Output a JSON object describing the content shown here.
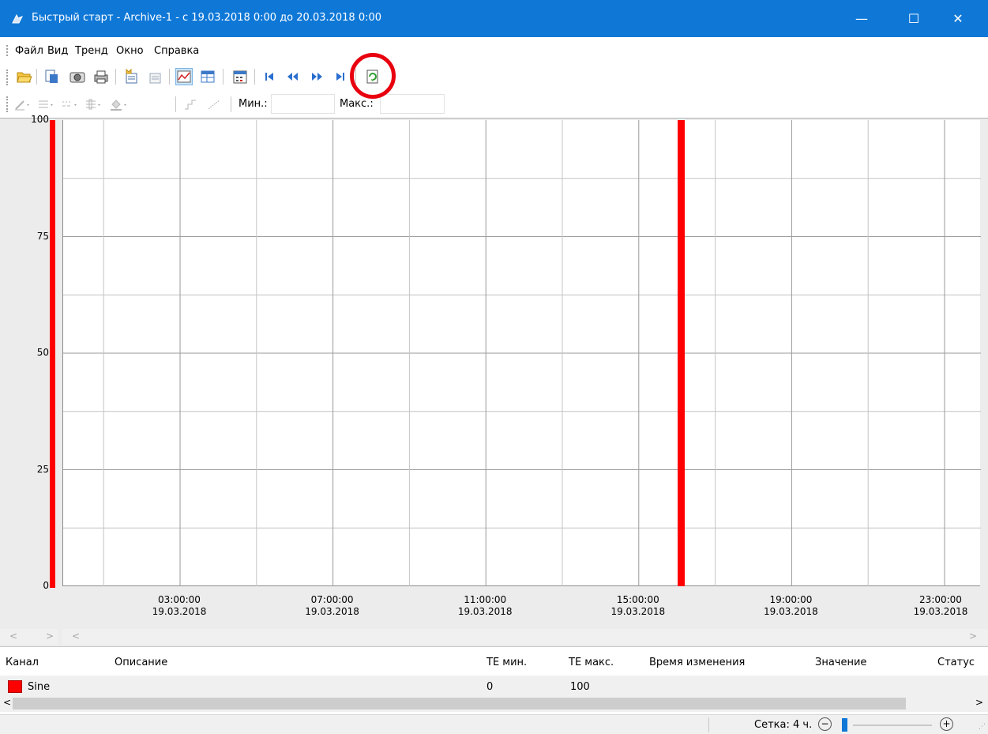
{
  "window": {
    "title": "Быстрый старт - Archive-1 - с 19.03.2018 0:00 до 20.03.2018 0:00",
    "minimize": "—",
    "maximize": "☐",
    "close": "✕",
    "accent_color": "#0f78d7"
  },
  "menu": {
    "items": [
      {
        "label": "Файл"
      },
      {
        "label": "Вид"
      },
      {
        "label": "Тренд"
      },
      {
        "label": "Окно"
      },
      {
        "label": "Справка"
      }
    ]
  },
  "toolbar": {
    "icons": [
      "open-folder-icon",
      "export-icon",
      "camera-icon",
      "print-icon",
      "add-channel-icon",
      "remove-channel-icon",
      "chart-view-icon",
      "table-view-icon",
      "calendar-icon",
      "first-icon",
      "back-icon",
      "forward-icon",
      "last-icon",
      "refresh-icon"
    ],
    "highlight_color": "#e8000e"
  },
  "toolbar2": {
    "min_label": "Мин.:",
    "max_label": "Макс.:",
    "min_value": "",
    "max_value": ""
  },
  "chart_data": {
    "type": "line",
    "yticks": [
      "100",
      "75",
      "50",
      "25",
      "0"
    ],
    "ylim": [
      0,
      100
    ],
    "xticks": [
      {
        "time": "03:00:00",
        "date": "19.03.2018"
      },
      {
        "time": "07:00:00",
        "date": "19.03.2018"
      },
      {
        "time": "11:00:00",
        "date": "19.03.2018"
      },
      {
        "time": "15:00:00",
        "date": "19.03.2018"
      },
      {
        "time": "19:00:00",
        "date": "19.03.2018"
      },
      {
        "time": "23:00:00",
        "date": "19.03.2018"
      }
    ],
    "grid": true,
    "series": [
      {
        "name": "Sine",
        "color": "#ff0000"
      }
    ]
  },
  "table": {
    "headers": [
      "Канал",
      "Описание",
      "ТЕ мин.",
      "ТЕ макс.",
      "Время изменения",
      "Значение",
      "Статус"
    ],
    "rows": [
      {
        "channel": "Sine",
        "description": "",
        "te_min": "0",
        "te_max": "100",
        "changed": "",
        "value": "",
        "status": "",
        "color": "#ff0000"
      }
    ]
  },
  "statusbar": {
    "grid_label": "Сетка: 4 ч."
  }
}
